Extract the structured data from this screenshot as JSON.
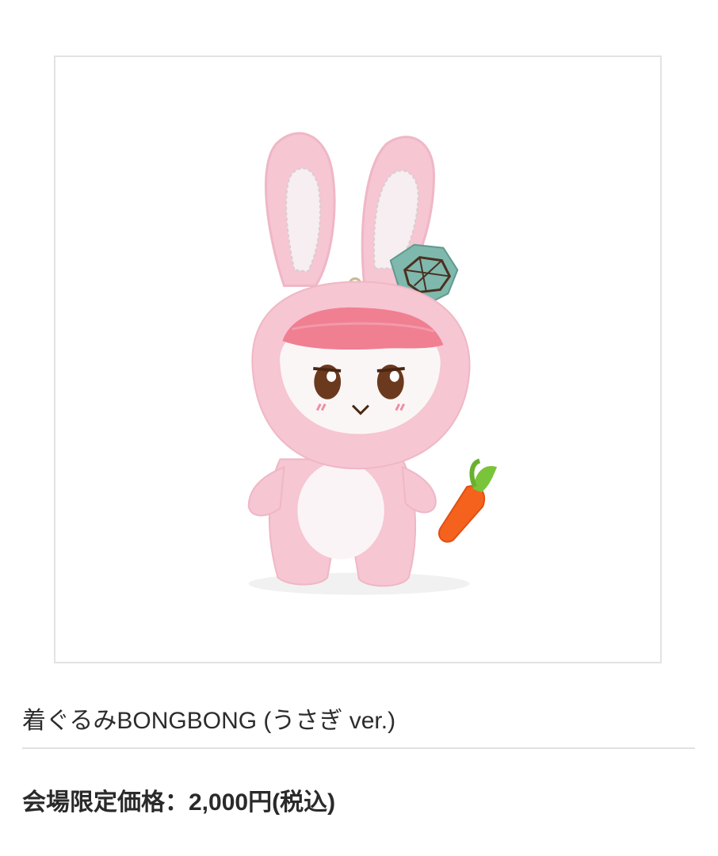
{
  "product": {
    "image_subject": "bunny-plush-keychain-icon",
    "title": "着ぐるみBONGBONG (うさぎ ver.)",
    "price": "会場限定価格：2,000円(税込)"
  },
  "colors": {
    "frame_border": "#e3e3e3",
    "plush_pink": "#f6c6d2",
    "plush_pink_dark": "#f0aabd",
    "visor_red": "#f07f92",
    "ear_inner": "#f6eef0",
    "carrot": "#f5621e",
    "carrot_leaf": "#7ac43a",
    "badge_teal": "#7fb8ac"
  }
}
